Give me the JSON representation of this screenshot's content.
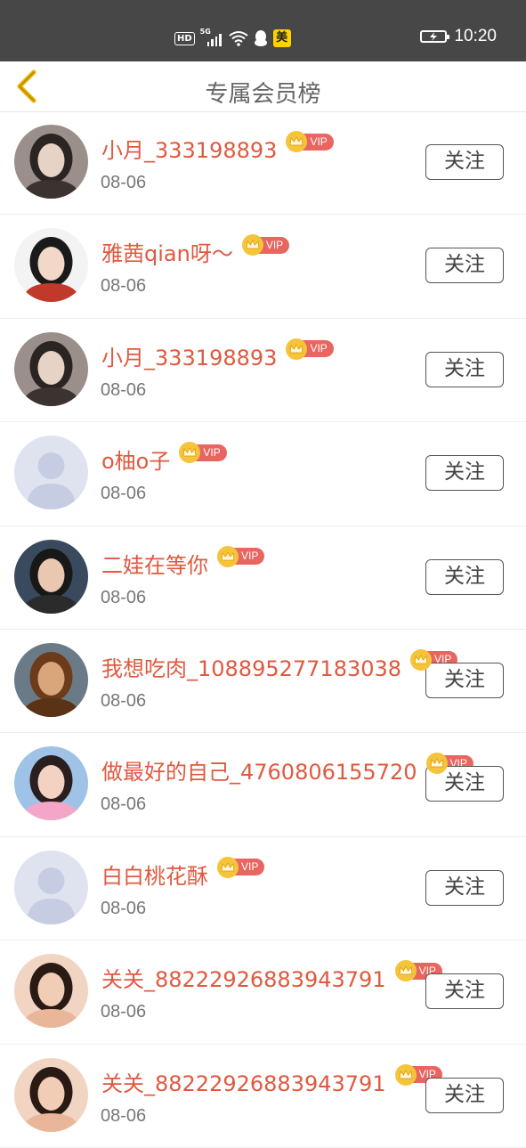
{
  "status_bar": {
    "hd": "HD",
    "network": "5G",
    "app_badge": "美",
    "time": "10:20"
  },
  "header": {
    "title": "专属会员榜"
  },
  "vip_label": "VIP",
  "follow_label": "关注",
  "members": [
    {
      "name": "小月_333198893",
      "date": "08-06",
      "avatar": "photo-woman"
    },
    {
      "name": "雅茜qian呀～",
      "date": "08-06",
      "avatar": "photo-red"
    },
    {
      "name": "小月_333198893",
      "date": "08-06",
      "avatar": "photo-woman"
    },
    {
      "name": "o柚o子",
      "date": "08-06",
      "avatar": "default"
    },
    {
      "name": "二娃在等你",
      "date": "08-06",
      "avatar": "photo-man"
    },
    {
      "name": "我想吃肉_108895277183038",
      "date": "08-06",
      "avatar": "photo-costume"
    },
    {
      "name": "做最好的自己_4760806155720",
      "date": "08-06",
      "avatar": "photo-outdoor"
    },
    {
      "name": "白白桃花酥",
      "date": "08-06",
      "avatar": "default"
    },
    {
      "name": "关关_88222926883943791",
      "date": "08-06",
      "avatar": "photo-girl"
    },
    {
      "name": "关关_88222926883943791",
      "date": "08-06",
      "avatar": "photo-girl"
    }
  ],
  "colors": {
    "status_bar": "#474747",
    "name": "#e0593f",
    "vip_tag": "#e86560",
    "crown": "#f6c43b",
    "back_arrow": "#e8b000"
  }
}
